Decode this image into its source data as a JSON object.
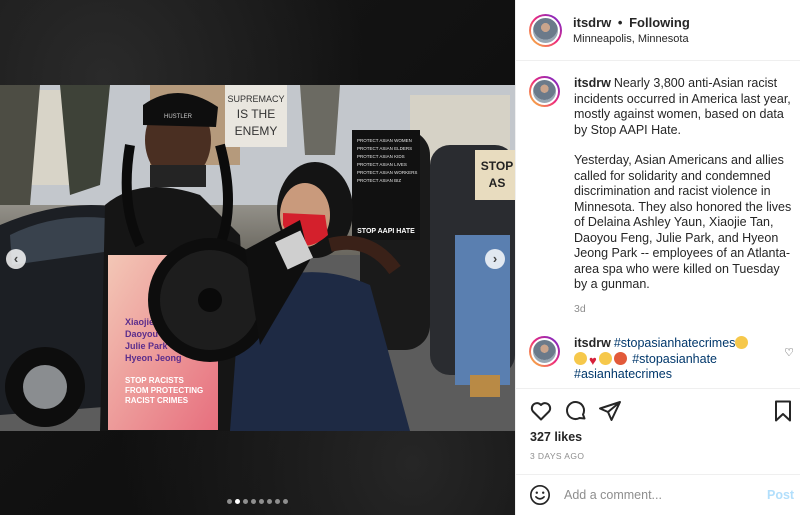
{
  "header": {
    "username": "itsdrw",
    "separator": "•",
    "follow_label": "Following",
    "location": "Minneapolis, Minnesota"
  },
  "media": {
    "slide_count": 8,
    "active_slide": 2,
    "signs": {
      "top_sign": "SUPREMACY IS THE ENEMY",
      "black_sign": "STOP AAPI HATE",
      "right_sign": "STOP AS",
      "bottom_sign": "STOP RACISTS FROM PROTECTING RACIST CRIMES",
      "bottom_sign_names": "Xiaojie Tan Daoyou Feng Julie Park Hyeon Jeong",
      "hat_text": "HUSTLER"
    }
  },
  "caption": {
    "username": "itsdrw",
    "paragraph1": "Nearly 3,800 anti-Asian racist incidents occurred in America last year, mostly against women, based on data by Stop AAPI Hate.",
    "paragraph2": "Yesterday, Asian Americans and allies called for solidarity and condemned discrimination and racist violence in Minnesota. They also honored the lives of Delaina Ashley Yaun, Xiaojie Tan, Daoyou Feng, Julie Park, and Hyeon Jeong Park -- employees of an Atlanta-area spa who were killed on Tuesday by a gunman.",
    "time": "3d"
  },
  "comment": {
    "username": "itsdrw",
    "hashtag1": "#stopasianhatecrimes",
    "hashtag2": "#stopasianhate",
    "hashtag3": "#asianhatecrimes"
  },
  "actions": {
    "likes": "327 likes",
    "date": "3 DAYS AGO",
    "icons": [
      "heart-icon",
      "comment-icon",
      "share-icon",
      "bookmark-icon"
    ]
  },
  "add_comment": {
    "placeholder": "Add a comment...",
    "post_label": "Post"
  },
  "colors": {
    "hashtag": "#00376b",
    "post_disabled": "#b2dffc",
    "muted": "#8e8e8e",
    "mask_red": "#d4202c"
  }
}
